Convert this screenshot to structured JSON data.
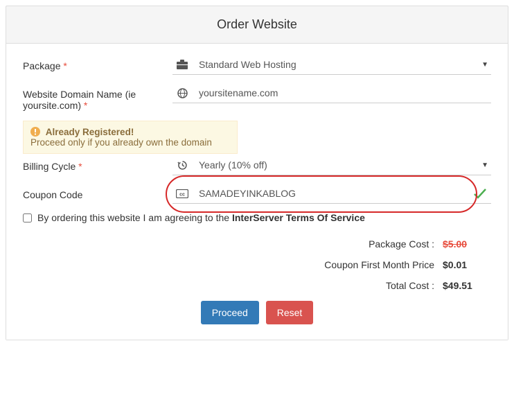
{
  "header": {
    "title": "Order Website"
  },
  "form": {
    "package": {
      "label": "Package",
      "required": "*",
      "value": "Standard Web Hosting",
      "icon": "briefcase-icon"
    },
    "domain": {
      "label": "Website Domain Name (ie yoursite.com)",
      "required": "*",
      "value": "yoursitename.com",
      "icon": "globe-icon"
    },
    "alert": {
      "title": "Already Registered!",
      "body": "Proceed only if you already own the domain"
    },
    "billing": {
      "label": "Billing Cycle",
      "required": "*",
      "value": "Yearly (10% off)",
      "icon": "history-icon"
    },
    "coupon": {
      "label": "Coupon Code",
      "value": "SAMADEYINKABLOG",
      "icon": "cc-icon",
      "valid": true
    }
  },
  "agreement": {
    "text_prefix": "By ordering this website I am agreeing to the ",
    "link": "InterServer Terms Of Service"
  },
  "summary": {
    "package_cost": {
      "label": "Package Cost :",
      "value": "$5.00"
    },
    "coupon_price": {
      "label": "Coupon First Month Price",
      "value": "$0.01"
    },
    "total": {
      "label": "Total Cost :",
      "value": "$49.51"
    }
  },
  "buttons": {
    "proceed": "Proceed",
    "reset": "Reset"
  }
}
